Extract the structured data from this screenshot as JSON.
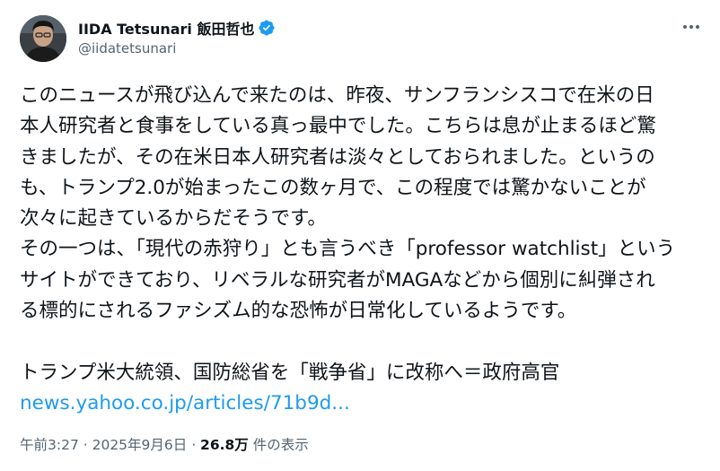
{
  "author": {
    "display_name": "IIDA Tetsunari 飯田哲也",
    "handle": "@iidatetsunari",
    "verified": true,
    "avatar_icon": "user-avatar"
  },
  "tweet": {
    "lines": [
      "このニュースが飛び込んで来たのは、昨夜、サンフランシスコで在米の日",
      "本人研究者と食事をしている真っ最中でした。こちらは息が止まるほど驚",
      "きましたが、その在米日本人研究者は淡々としておられました。というの",
      "も、トランプ2.0が始まったこの数ヶ月で、この程度では驚かないことが",
      "次々に起きているからだそうです。",
      "その一つは、「現代の赤狩り」とも言うべき「professor watchlist」という",
      "サイトができており、リベラルな研究者がMAGAなどから個別に糾弾され",
      "る標的にされるファシズム的な恐怖が日常化しているようです。"
    ],
    "headline": "トランプ米大統領、国防総省を「戦争省」に改称へ＝政府高官",
    "link_text": "news.yahoo.co.jp/articles/71b9d..."
  },
  "meta": {
    "time": "午前3:27",
    "separator": " · ",
    "date": "2025年9月6日",
    "separator2": " · ",
    "views_count": "26.8万",
    "views_label": " 件の表示"
  },
  "colors": {
    "text": "#0f1419",
    "secondary": "#536471",
    "link": "#1d9bf0",
    "verified_badge": "#1d9bf0"
  },
  "icons": {
    "verified": "verified-badge-icon",
    "more": "more-options-icon"
  }
}
